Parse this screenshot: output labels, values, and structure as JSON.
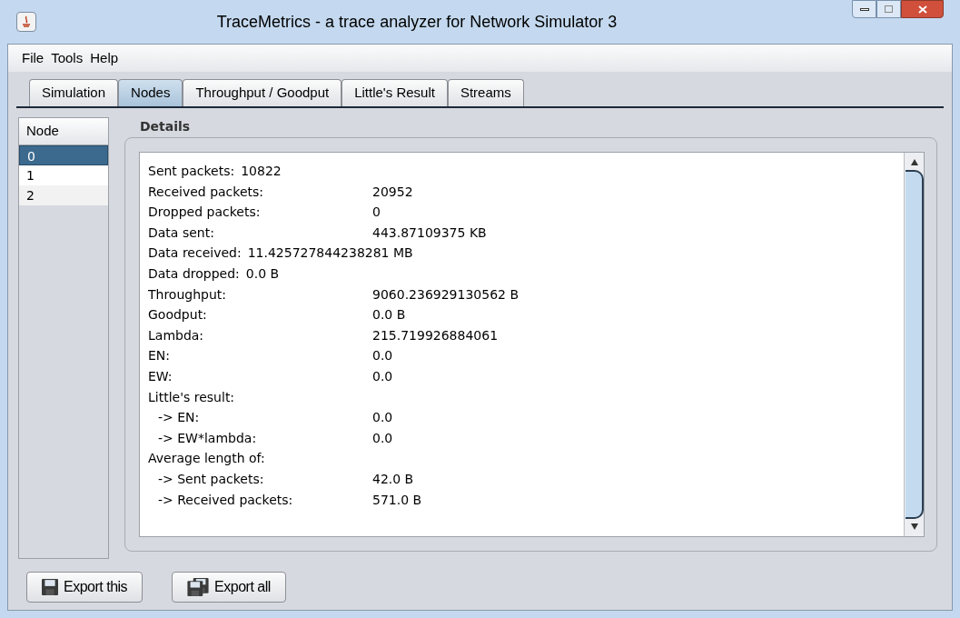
{
  "window": {
    "title": "TraceMetrics - a trace analyzer for Network Simulator 3"
  },
  "menu": [
    "File",
    "Tools",
    "Help"
  ],
  "tabs": [
    {
      "label": "Simulation",
      "selected": false
    },
    {
      "label": "Nodes",
      "selected": true
    },
    {
      "label": "Throughput / Goodput",
      "selected": false
    },
    {
      "label": "Little's Result",
      "selected": false
    },
    {
      "label": "Streams",
      "selected": false
    }
  ],
  "node_list": {
    "header": "Node",
    "items": [
      {
        "label": "0",
        "selected": true
      },
      {
        "label": "1",
        "selected": false
      },
      {
        "label": "2",
        "selected": false
      }
    ]
  },
  "details": {
    "title": "Details",
    "lines": [
      {
        "kind": "inline",
        "label": "Sent packets:",
        "value": "10822"
      },
      {
        "kind": "column",
        "label": "Received packets:",
        "value": "20952"
      },
      {
        "kind": "column",
        "label": "Dropped packets:",
        "value": "0"
      },
      {
        "kind": "column",
        "label": "Data sent:",
        "value": "443.87109375 KB"
      },
      {
        "kind": "inline",
        "label": "Data received:",
        "value": "11.425727844238281 MB"
      },
      {
        "kind": "inline",
        "label": "Data dropped:",
        "value": "0.0 B"
      },
      {
        "kind": "column",
        "label": "Throughput:",
        "value": "9060.236929130562 B"
      },
      {
        "kind": "column",
        "label": "Goodput:",
        "value": "0.0 B"
      },
      {
        "kind": "column",
        "label": "Lambda:",
        "value": "215.719926884061"
      },
      {
        "kind": "column",
        "label": "EN:",
        "value": "0.0"
      },
      {
        "kind": "column",
        "label": "EW:",
        "value": "0.0"
      },
      {
        "kind": "heading",
        "label": "Little's result:"
      },
      {
        "kind": "sub",
        "label": "-> EN:",
        "value": "0.0"
      },
      {
        "kind": "sub",
        "label": "-> EW*lambda:",
        "value": "0.0"
      },
      {
        "kind": "heading",
        "label": "Average length of:"
      },
      {
        "kind": "sub",
        "label": "-> Sent packets:",
        "value": "42.0 B"
      },
      {
        "kind": "sub",
        "label": "-> Received packets:",
        "value": "571.0 B"
      }
    ]
  },
  "buttons": [
    {
      "label": "Export this",
      "kind": "single"
    },
    {
      "label": "Export all",
      "kind": "multi"
    }
  ]
}
